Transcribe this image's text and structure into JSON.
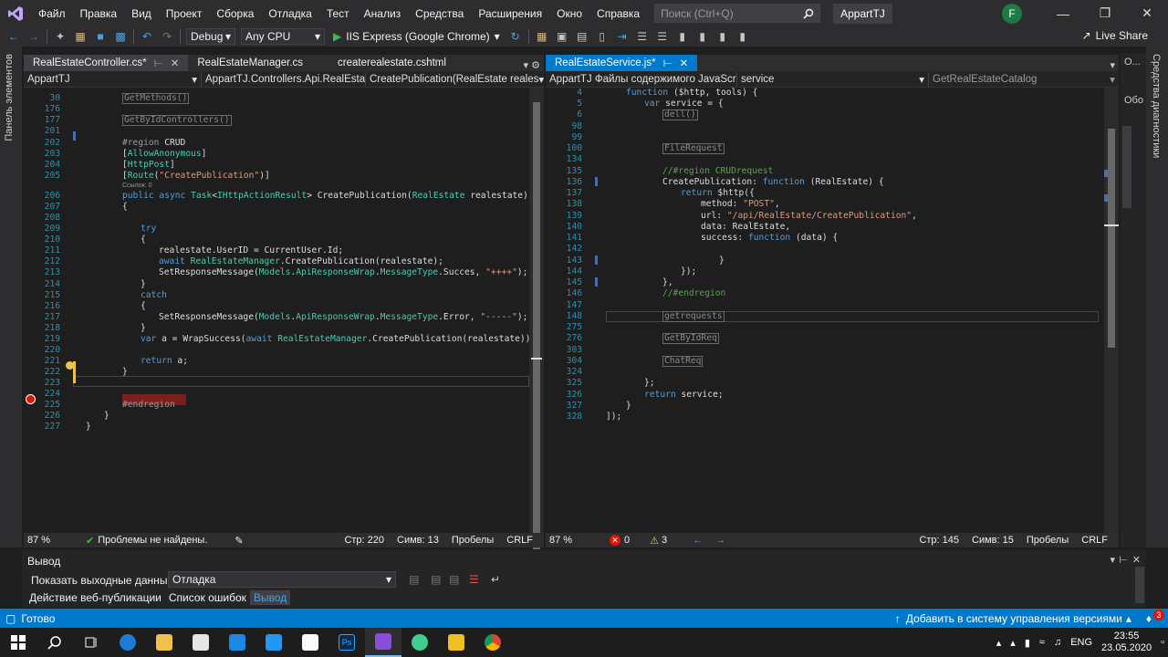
{
  "menu": {
    "items": [
      "Файл",
      "Правка",
      "Вид",
      "Проект",
      "Сборка",
      "Отладка",
      "Тест",
      "Анализ",
      "Средства",
      "Расширения",
      "Окно",
      "Справка"
    ],
    "search_placeholder": "Поиск (Ctrl+Q)",
    "solution_title": "AppartTJ",
    "account_initial": "F"
  },
  "toolbar": {
    "config": "Debug",
    "platform": "Any CPU",
    "run_target": "IIS Express (Google Chrome)",
    "live_share": "Live Share"
  },
  "side": {
    "left_label": "Панель элементов",
    "right_label": "Средства диагностики",
    "obo_label": "Обо",
    "obo_top": "O..."
  },
  "left_editor": {
    "tabs": [
      {
        "label": "RealEstateController.cs*",
        "active": true
      },
      {
        "label": "RealEstateManager.cs",
        "active": false
      },
      {
        "label": "createrealestate.cshtml",
        "active": false
      }
    ],
    "nav": {
      "project": "AppartTJ",
      "class": "AppartTJ.Controllers.Api.RealEstateC",
      "member": "CreatePublication(RealEstate reales"
    },
    "references": "Ссылок: 0",
    "status": {
      "zoom": "87 %",
      "issues": "Проблемы не найдены.",
      "line": "Стр: 220",
      "col": "Симв: 13",
      "ws": "Пробелы",
      "eol": "CRLF"
    }
  },
  "right_editor": {
    "tabs": [
      {
        "label": "RealEstateService.js*",
        "active": true
      }
    ],
    "nav": {
      "project": "AppartTJ Файлы содержимого JavaScri",
      "scope": "service",
      "member": "GetRealEstateCatalog"
    },
    "status": {
      "zoom": "87 %",
      "errors": "0",
      "warnings": "3",
      "line": "Стр: 145",
      "col": "Симв: 15",
      "ws": "Пробелы",
      "eol": "CRLF"
    }
  },
  "output": {
    "title": "Вывод",
    "show_label": "Показать выходные данные из:",
    "source": "Отладка",
    "tabs": [
      "Действие веб-публикации",
      "Список ошибок",
      "Вывод"
    ]
  },
  "statusbar": {
    "ready": "Готово",
    "source_control": "Добавить в систему управления версиями",
    "notifications": "3"
  },
  "taskbar": {
    "lang": "ENG",
    "time": "23:55",
    "date": "23.05.2020"
  },
  "colors": {
    "accent": "#007acc",
    "chrome": "#2d2d30",
    "editor_bg": "#1e1e1e",
    "breakpoint": "#e51400"
  }
}
